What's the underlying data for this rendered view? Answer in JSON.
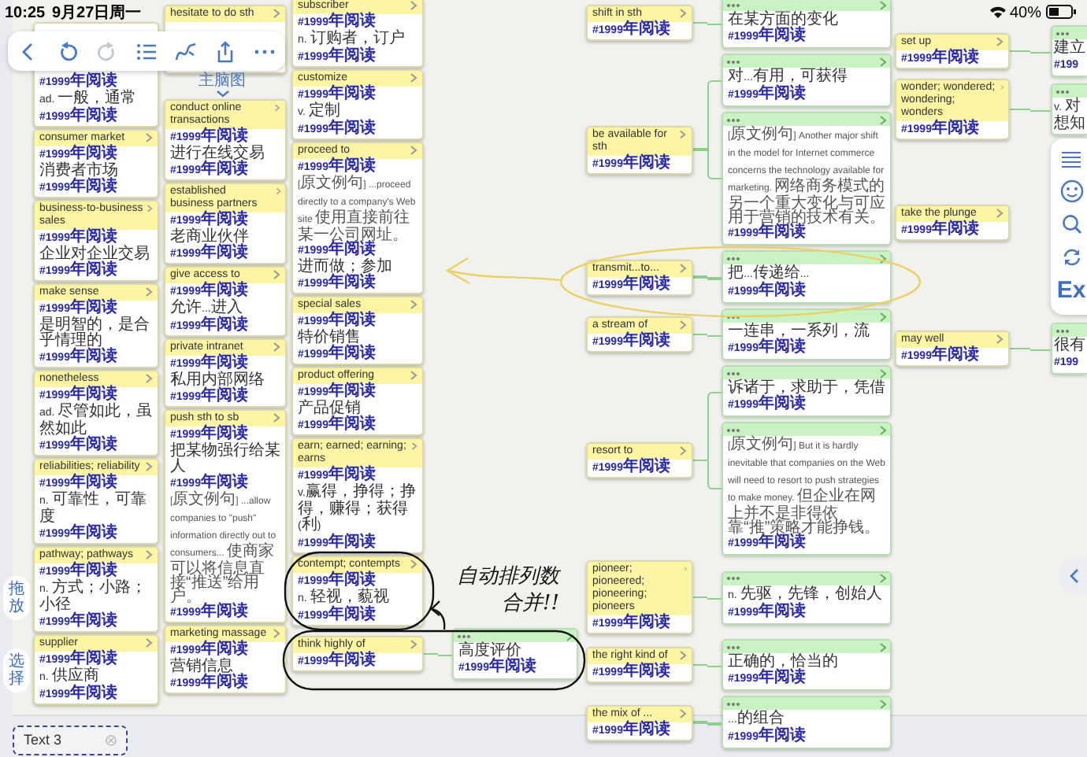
{
  "status_bar": {
    "time": "10:25",
    "date": "9月27日周一",
    "battery": "40%"
  },
  "toolbar": [
    {
      "kind": "back",
      "disabled": false
    },
    {
      "kind": "undo",
      "disabled": false
    },
    {
      "kind": "redo",
      "disabled": true
    },
    {
      "kind": "outline",
      "disabled": false
    },
    {
      "kind": "curve",
      "disabled": false
    },
    {
      "kind": "share",
      "disabled": false
    },
    {
      "kind": "more",
      "disabled": false
    }
  ],
  "map_label": "主脑图",
  "columns": [
    {
      "cards": [
        {
          "title_covered": true,
          "lines": [
            {
              "tag": "#1999年阅读"
            },
            {
              "text": "ad. 一般，通常"
            },
            {
              "tag": "#1999年阅读"
            }
          ]
        },
        {
          "title": "consumer market",
          "lines": [
            {
              "tag": "#1999年阅读"
            },
            {
              "text": "消费者市场"
            },
            {
              "tag": "#1999年阅读"
            }
          ]
        },
        {
          "title": "business-to-business sales",
          "lines": [
            {
              "tag": "#1999年阅读"
            },
            {
              "text": "企业对企业交易"
            },
            {
              "tag": "#1999年阅读"
            }
          ]
        },
        {
          "title": "make sense",
          "lines": [
            {
              "tag": "#1999年阅读"
            },
            {
              "text": "是明智的，是合乎情理的"
            },
            {
              "tag": "#1999年阅读"
            }
          ]
        },
        {
          "title": "nonetheless",
          "lines": [
            {
              "tag": "#1999年阅读"
            },
            {
              "text": "ad. 尽管如此，虽然如此"
            },
            {
              "tag": "#1999年阅读"
            }
          ]
        },
        {
          "title": "reliabilities; reliability",
          "lines": [
            {
              "tag": "#1999年阅读"
            },
            {
              "text": "n. 可靠性，可靠度"
            },
            {
              "tag": "#1999年阅读"
            }
          ]
        },
        {
          "title": "pathway; pathways",
          "lines": [
            {
              "tag": "#1999年阅读"
            },
            {
              "text": "n. 方式；小路；小径"
            },
            {
              "tag": "#1999年阅读"
            }
          ]
        },
        {
          "title": "supplier",
          "lines": [
            {
              "tag": "#1999年阅读"
            },
            {
              "text": "n. 供应商"
            },
            {
              "tag": "#1999年阅读"
            }
          ]
        }
      ]
    },
    {
      "cards": [
        {
          "title": "hesitate to do sth",
          "body_covered": true
        },
        {
          "title": "conduct online transactions",
          "lines": [
            {
              "tag": "#1999年阅读"
            },
            {
              "text": "进行在线交易"
            },
            {
              "tag": "#1999年阅读"
            }
          ]
        },
        {
          "title": "established business partners",
          "lines": [
            {
              "tag": "#1999年阅读"
            },
            {
              "text": "老商业伙伴"
            },
            {
              "tag": "#1999年阅读"
            }
          ]
        },
        {
          "title": "give access to",
          "lines": [
            {
              "tag": "#1999年阅读"
            },
            {
              "text": "允许...进入"
            },
            {
              "tag": "#1999年阅读"
            }
          ]
        },
        {
          "title": "private intranet",
          "lines": [
            {
              "tag": "#1999年阅读"
            },
            {
              "text": "私用内部网络"
            },
            {
              "tag": "#1999年阅读"
            }
          ]
        },
        {
          "title": "push sth to sb",
          "lines": [
            {
              "tag": "#1999年阅读"
            },
            {
              "text": "把某物强行给某人"
            },
            {
              "tag": "#1999年阅读"
            },
            {
              "example": "[原文例句] ...allow companies to \"push\" information directly out to consumers... 使商家可以将信息直接“推送”给用户。"
            },
            {
              "tag": "#1999年阅读"
            }
          ]
        },
        {
          "title": "marketing massage",
          "lines": [
            {
              "tag": "#1999年阅读"
            },
            {
              "text": "营销信息"
            },
            {
              "tag": "#1999年阅读"
            }
          ]
        }
      ]
    },
    {
      "cards": [
        {
          "title": "subscriber",
          "lines": [
            {
              "tag": "#1999年阅读"
            },
            {
              "text": "n. 订购者，订户"
            },
            {
              "tag": "#1999年阅读"
            }
          ]
        },
        {
          "title": "customize",
          "lines": [
            {
              "tag": "#1999年阅读"
            },
            {
              "text": "v. 定制"
            },
            {
              "tag": "#1999年阅读"
            }
          ]
        },
        {
          "title": "proceed to",
          "lines": [
            {
              "tag": "#1999年阅读"
            },
            {
              "example": "[原文例句] ...proceed directly to a company's Web site 使用直接前往某一公司网址。"
            },
            {
              "tag": "#1999年阅读"
            },
            {
              "text": "进而做；参加"
            },
            {
              "tag": "#1999年阅读"
            }
          ]
        },
        {
          "title": "special sales",
          "lines": [
            {
              "tag": "#1999年阅读"
            },
            {
              "text": "特价销售"
            },
            {
              "tag": "#1999年阅读"
            }
          ]
        },
        {
          "title": "product offering",
          "lines": [
            {
              "tag": "#1999年阅读"
            },
            {
              "text": "产品促销"
            },
            {
              "tag": "#1999年阅读"
            }
          ]
        },
        {
          "title": "earn; earned; earning; earns",
          "lines": [
            {
              "tag": "#1999年阅读"
            },
            {
              "text": "v.赢得，挣得；挣得，赚得；获得(利)"
            },
            {
              "tag": "#1999年阅读"
            }
          ]
        },
        {
          "title": "contempt; contempts",
          "lines": [
            {
              "tag": "#1999年阅读"
            },
            {
              "text": "n. 轻视，藐视"
            },
            {
              "tag": "#1999年阅读"
            }
          ]
        },
        {
          "title": "think highly of",
          "lines": [
            {
              "tag": "#1999年阅读"
            }
          ],
          "children": [
            {
              "lines": [
                {
                  "text": "高度评价"
                },
                {
                  "tag": "#1999年阅读"
                }
              ]
            }
          ]
        }
      ]
    }
  ],
  "branches": [
    {
      "title": "shift in sth",
      "lines": [
        {
          "tag": "#1999年阅读"
        }
      ],
      "children": [
        {
          "lines": [
            {
              "text": "在某方面的变化"
            },
            {
              "tag": "#1999年阅读"
            }
          ]
        }
      ]
    },
    {
      "title": "be available for sth",
      "lines": [
        {
          "tag": "#1999年阅读"
        }
      ],
      "children": [
        {
          "lines": [
            {
              "text": "对...有用，可获得"
            },
            {
              "tag": "#1999年阅读"
            }
          ]
        },
        {
          "lines": [
            {
              "example": "[原文例句] Another major shift in the model for Internet commerce concerns the technology available for marketing. 网络商务模式的另一个重大变化与可应用于营销的技术有关。"
            },
            {
              "tag": "#1999年阅读"
            }
          ]
        }
      ]
    },
    {
      "title": "transmit...to...",
      "lines": [
        {
          "tag": "#1999年阅读"
        }
      ],
      "children": [
        {
          "lines": [
            {
              "text": "把...传递给..."
            },
            {
              "tag": "#1999年阅读"
            }
          ]
        }
      ]
    },
    {
      "title": "a stream of",
      "lines": [
        {
          "tag": "#1999年阅读"
        }
      ],
      "children": [
        {
          "lines": [
            {
              "text": "一连串，一系列，流"
            },
            {
              "tag": "#1999年阅读"
            }
          ]
        }
      ]
    },
    {
      "title": "resort to",
      "lines": [
        {
          "tag": "#1999年阅读"
        }
      ],
      "children": [
        {
          "lines": [
            {
              "text": "诉诸于，求助于，凭借"
            },
            {
              "tag": "#1999年阅读"
            }
          ]
        },
        {
          "lines": [
            {
              "example": "[原文例句] But it is hardly inevitable that companies on the Web will need to resort to push strategies to make money. 但企业在网上并不是非得依靠“推”策略才能挣钱。"
            },
            {
              "tag": "#1999年阅读"
            }
          ]
        }
      ]
    },
    {
      "title": "pioneer; pioneered; pioneering; pioneers",
      "lines": [
        {
          "tag": "#1999年阅读"
        }
      ],
      "children": [
        {
          "lines": [
            {
              "text": "n. 先驱，先锋，创始人"
            },
            {
              "tag": "#1999年阅读"
            }
          ]
        }
      ]
    },
    {
      "title": "the right kind of",
      "lines": [
        {
          "tag": "#1999年阅读"
        }
      ],
      "children": [
        {
          "lines": [
            {
              "text": "正确的，恰当的"
            },
            {
              "tag": "#1999年阅读"
            }
          ]
        }
      ]
    },
    {
      "title": "the mix of ...",
      "lines": [
        {
          "tag": "#1999年阅读"
        }
      ],
      "children": [
        {
          "lines": [
            {
              "text": "...的组合"
            },
            {
              "tag": "#1999年阅读"
            }
          ]
        }
      ]
    }
  ],
  "far_branches": [
    {
      "title": "set up",
      "lines": [
        {
          "tag": "#1999年阅读"
        }
      ],
      "children": [
        {
          "lines": [
            {
              "text": "建立"
            },
            {
              "tag": "#199"
            }
          ]
        }
      ]
    },
    {
      "title": "wonder; wondered; wondering; wonders",
      "lines": [
        {
          "tag": "#1999年阅读"
        }
      ],
      "children": [
        {
          "lines": [
            {
              "text": "v. 对"
            },
            {
              "text": "想知"
            }
          ]
        }
      ]
    },
    {
      "title": "take the plunge",
      "lines": [
        {
          "tag": "#1999年阅读"
        }
      ]
    },
    {
      "title": "may well",
      "lines": [
        {
          "tag": "#1999年阅读"
        }
      ],
      "children": [
        {
          "lines": [
            {
              "text": "很有"
            },
            {
              "tag": "#199"
            }
          ]
        }
      ]
    }
  ],
  "side_panel": {
    "label": "Ex"
  },
  "mode_buttons": [
    "拖放",
    "选择"
  ],
  "annotation": {
    "lines": [
      "自动排列数",
      "合并!!"
    ]
  },
  "text_box": "Text 3"
}
